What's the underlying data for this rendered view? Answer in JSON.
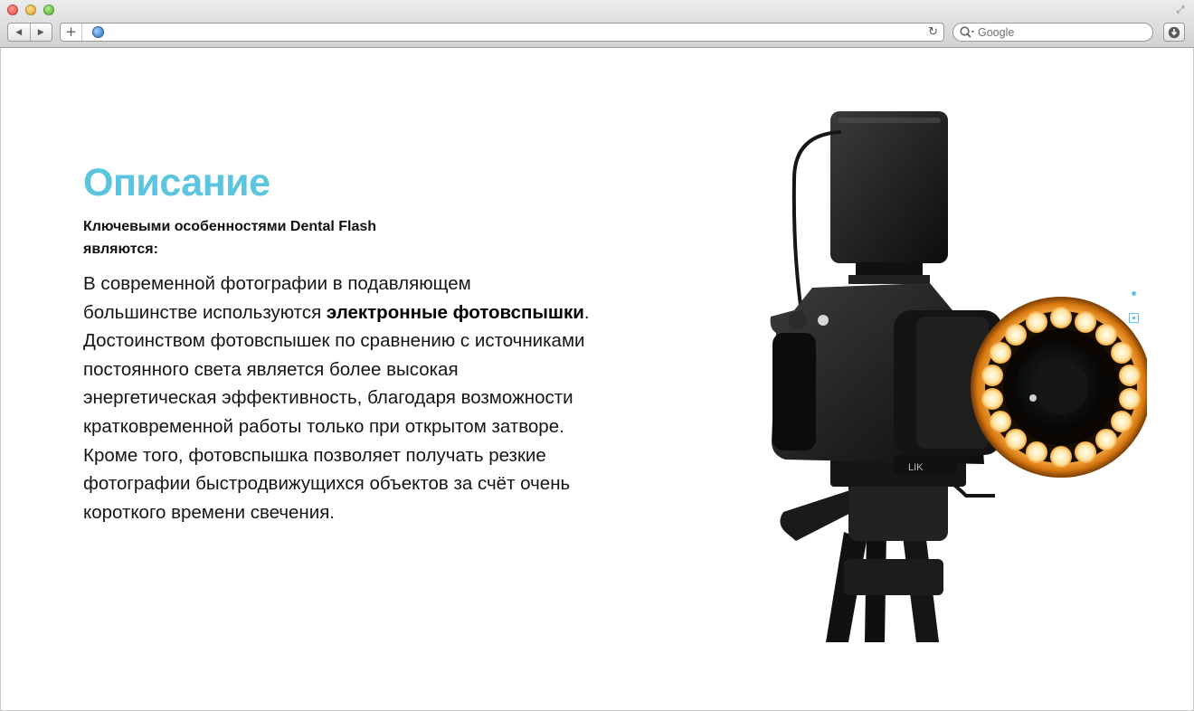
{
  "browser": {
    "url": "",
    "search_placeholder": "Google",
    "icons": {
      "back": "back-arrow-icon",
      "forward": "forward-arrow-icon",
      "add_tab": "plus-icon",
      "site": "globe-icon",
      "reload": "reload-icon",
      "search": "search-icon",
      "downloads": "download-icon",
      "fullscreen": "fullscreen-icon"
    }
  },
  "page": {
    "title": "Описание",
    "subtitle": "Ключевыми особенностями Dental Flash являются:",
    "body": {
      "part1": "В современной фотографии в подавляющем большинстве используются ",
      "bold1": "электронные фотовспышки",
      "part2": ". Достоинством фотовспышек по сравнению с источниками постоянного света является более высокая энергетическая эффективность, благодаря возможности кратковременной работы только при открытом затворе. Кроме того, фотовспышка позволяет получать резкие фотографии быстродвижущихся объектов за счёт очень короткого времени свечения."
    },
    "image_brand_text": "LIK"
  },
  "colors": {
    "accent": "#5bc5e0",
    "ring_light": "#f5a028",
    "text": "#151515"
  }
}
